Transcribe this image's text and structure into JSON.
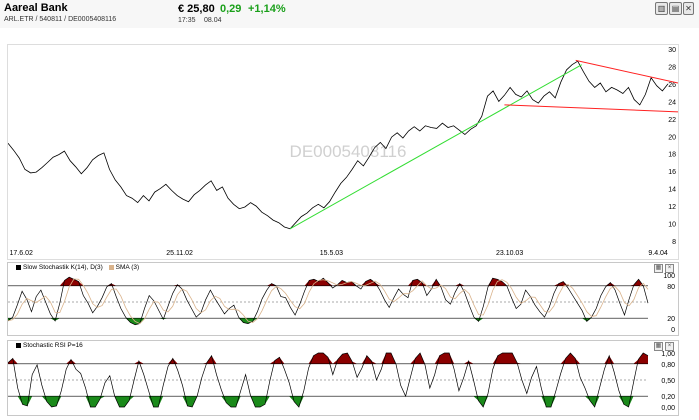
{
  "header": {
    "company": "Aareal Bank",
    "ids": "ARL.ETR  /  540811  /  DE0005408116",
    "price": "€ 25,80",
    "change": "0,29",
    "change_pct": "+1,14%",
    "time": "17:35",
    "date": "08.04",
    "buttons": [
      "chart-icon",
      "chart-icon",
      "settings-icon",
      "close-icon"
    ]
  },
  "colors": {
    "positive": "#1aa01a",
    "trend": "#33dd33",
    "channel": "#ff2222",
    "overbought": "#8b0000",
    "oversold": "#1a8a1a"
  },
  "chart_data": [
    {
      "type": "line",
      "watermark": "DE0005408116",
      "x_ticks": [
        "17.6.02",
        "25.11.02",
        "15.5.03",
        "23.10.03",
        "9.4.04"
      ],
      "y_ticks": [
        "8",
        "10",
        "12",
        "14",
        "16",
        "18",
        "20",
        "22",
        "24",
        "26",
        "28",
        "30"
      ],
      "ylim": [
        8,
        30
      ],
      "series": [
        {
          "values": [
            19.2,
            18.4,
            17.5,
            16.2,
            15.8,
            15.9,
            16.4,
            17.0,
            17.6,
            17.9,
            18.3,
            17.2,
            16.5,
            15.7,
            16.4,
            17.3,
            17.8,
            18.1,
            16.2,
            15.0,
            14.2,
            13.2,
            12.9,
            12.4,
            13.2,
            12.6,
            13.6,
            14.0,
            14.5,
            13.8,
            13.2,
            12.8,
            12.5,
            13.3,
            13.8,
            14.4,
            14.9,
            13.8,
            14.2,
            12.9,
            12.2,
            11.7,
            11.9,
            12.4,
            12.0,
            11.3,
            10.9,
            10.4,
            10.1,
            9.6,
            9.4,
            10.1,
            10.8,
            11.2,
            11.8,
            12.2,
            11.8,
            12.5,
            13.6,
            14.6,
            15.3,
            16.2,
            17.2,
            16.6,
            17.6,
            18.7,
            19.3,
            18.6,
            19.9,
            20.4,
            19.8,
            20.6,
            21.1,
            20.6,
            21.2,
            21.0,
            20.9,
            21.5,
            21.0,
            21.2,
            20.7,
            20.2,
            20.8,
            21.2,
            22.3,
            24.6,
            25.2,
            24.0,
            24.7,
            25.6,
            24.8,
            24.5,
            25.2,
            24.2,
            23.8,
            24.6,
            25.1,
            24.4,
            26.2,
            27.6,
            28.2,
            28.6,
            27.4,
            26.3,
            25.6,
            26.1,
            25.1,
            25.6,
            25.3,
            24.9,
            25.6,
            24.2,
            23.6,
            24.8,
            26.7,
            25.8,
            25.2,
            26.0
          ]
        }
      ]
    },
    {
      "type": "line",
      "title": "Slow Stochastik K(14), D(3)",
      "legend": "SMA (3)",
      "y_ticks": [
        "100",
        "80",
        "20",
        "0"
      ],
      "ylim": [
        0,
        100
      ],
      "levels": [
        20,
        50,
        80
      ],
      "series": [
        {
          "values": [
            15,
            22,
            45,
            70,
            55,
            32,
            60,
            72,
            50,
            28,
            15,
            48,
            90,
            96,
            92,
            88,
            62,
            48,
            30,
            42,
            58,
            78,
            84,
            60,
            38,
            22,
            12,
            8,
            10,
            38,
            62,
            52,
            35,
            18,
            42,
            66,
            82,
            74,
            54,
            38,
            22,
            30,
            54,
            72,
            56,
            42,
            28,
            38,
            44,
            22,
            12,
            10,
            14,
            32,
            56,
            72,
            84,
            80,
            60,
            58,
            40,
            26,
            46,
            70,
            90,
            92,
            88,
            94,
            86,
            76,
            82,
            90,
            86,
            88,
            80,
            74,
            88,
            92,
            86,
            72,
            54,
            40,
            58,
            74,
            64,
            58,
            90,
            92,
            86,
            62,
            74,
            92,
            78,
            54,
            46,
            68,
            84,
            68,
            44,
            22,
            14,
            42,
            78,
            94,
            92,
            88,
            80,
            58,
            38,
            46,
            72,
            60,
            44,
            32,
            22,
            40,
            66,
            84,
            88,
            76,
            62,
            48,
            34,
            14,
            22,
            38,
            62,
            78,
            86,
            72,
            48,
            26,
            56,
            82,
            92,
            80,
            48
          ]
        }
      ]
    },
    {
      "type": "line",
      "title": "Stochastic RSI P=16",
      "y_ticks": [
        "1,00",
        "0,80",
        "0,50",
        "0,20",
        "0,00"
      ],
      "ylim": [
        0,
        1
      ],
      "levels": [
        0.2,
        0.5,
        0.8
      ],
      "series": [
        {
          "values": [
            0.82,
            0.9,
            0.35,
            0.05,
            0.02,
            0.6,
            0.78,
            0.4,
            0.1,
            0.0,
            0.02,
            0.3,
            0.7,
            0.88,
            0.7,
            0.62,
            0.35,
            0.0,
            0.0,
            0.15,
            0.45,
            0.58,
            0.2,
            0.0,
            0.0,
            0.12,
            0.5,
            0.85,
            0.6,
            0.3,
            0.0,
            0.0,
            0.4,
            0.75,
            0.9,
            0.68,
            0.4,
            0.02,
            0.0,
            0.2,
            0.55,
            0.82,
            0.95,
            0.6,
            0.32,
            0.08,
            0.0,
            0.0,
            0.3,
            0.6,
            0.22,
            0.0,
            0.0,
            0.05,
            0.48,
            0.86,
            0.92,
            0.7,
            0.45,
            0.1,
            0.0,
            0.3,
            0.72,
            0.95,
            1.0,
            1.0,
            0.92,
            0.6,
            0.88,
            0.98,
            1.0,
            0.84,
            0.55,
            0.72,
            0.95,
            0.85,
            0.5,
            0.7,
            1.0,
            1.0,
            0.8,
            0.4,
            0.2,
            0.55,
            0.9,
            1.0,
            0.78,
            0.35,
            0.6,
            0.95,
            1.0,
            1.0,
            0.7,
            0.3,
            0.55,
            0.85,
            0.5,
            0.12,
            0.0,
            0.25,
            0.7,
            0.95,
            1.0,
            1.0,
            1.0,
            0.82,
            0.5,
            0.25,
            0.55,
            0.75,
            0.35,
            0.0,
            0.0,
            0.3,
            0.62,
            0.9,
            1.0,
            0.9,
            0.55,
            0.35,
            0.12,
            0.0,
            0.35,
            0.7,
            0.95,
            0.65,
            0.3,
            0.05,
            0.0,
            0.45,
            0.88,
            1.0,
            0.95
          ]
        }
      ]
    }
  ]
}
